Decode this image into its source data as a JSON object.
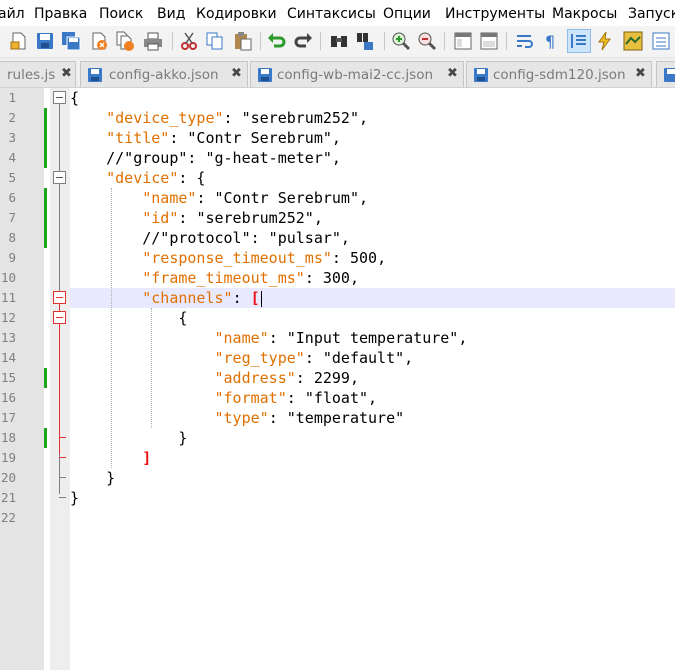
{
  "menu": {
    "items": [
      "айл",
      "Правка",
      "Поиск",
      "Вид",
      "Кодировки",
      "Синтаксисы",
      "Опции",
      "Инструменты",
      "Макросы",
      "Запуск"
    ]
  },
  "toolbar": {
    "buttons": [
      "new-file-icon",
      "save-icon",
      "save-all-icon",
      "close-icon",
      "close-all-icon",
      "print-icon",
      "cut-icon",
      "copy-icon",
      "paste-icon",
      "undo-icon",
      "redo-icon",
      "find-icon",
      "replace-icon",
      "zoom-in-icon",
      "zoom-out-icon",
      "sync-vertical-icon",
      "sync-horizontal-icon",
      "word-wrap-icon",
      "show-all-chars-icon",
      "indent-guide-icon",
      "user-defined-language-icon",
      "doc-map-icon",
      "function-list-icon"
    ]
  },
  "tabs": [
    {
      "label": "rules.js",
      "close": "✖"
    },
    {
      "label": "config-akko.json",
      "close": "✖"
    },
    {
      "label": "config-wb-mai2-cc.json",
      "close": "✖"
    },
    {
      "label": "config-sdm120.json",
      "close": "✖"
    }
  ],
  "editor": {
    "line_numbers": [
      "1",
      "2",
      "3",
      "4",
      "5",
      "6",
      "7",
      "8",
      "9",
      "10",
      "11",
      "12",
      "13",
      "14",
      "15",
      "16",
      "17",
      "18",
      "19",
      "20",
      "21",
      "22"
    ],
    "current_line": 11,
    "code": [
      {
        "i": "",
        "t": [
          [
            "p",
            "{"
          ]
        ]
      },
      {
        "i": "    ",
        "t": [
          [
            "k",
            "\"device_type\""
          ],
          [
            "p",
            ": "
          ],
          [
            "s",
            "\"serebrum252\""
          ],
          [
            "p",
            ","
          ]
        ]
      },
      {
        "i": "    ",
        "t": [
          [
            "k",
            "\"title\""
          ],
          [
            "p",
            ": "
          ],
          [
            "s",
            "\"Contr Serebrum\""
          ],
          [
            "p",
            ","
          ]
        ]
      },
      {
        "i": "    ",
        "t": [
          [
            "p",
            "//\"group\": \"g-heat-meter\","
          ]
        ]
      },
      {
        "i": "    ",
        "t": [
          [
            "k",
            "\"device\""
          ],
          [
            "p",
            ": {"
          ]
        ]
      },
      {
        "i": "        ",
        "t": [
          [
            "k",
            "\"name\""
          ],
          [
            "p",
            ": "
          ],
          [
            "s",
            "\"Contr Serebrum\""
          ],
          [
            "p",
            ","
          ]
        ]
      },
      {
        "i": "        ",
        "t": [
          [
            "k",
            "\"id\""
          ],
          [
            "p",
            ": "
          ],
          [
            "s",
            "\"serebrum252\""
          ],
          [
            "p",
            ","
          ]
        ]
      },
      {
        "i": "        ",
        "t": [
          [
            "p",
            "//\"protocol\": \"pulsar\","
          ]
        ]
      },
      {
        "i": "        ",
        "t": [
          [
            "k",
            "\"response_timeout_ms\""
          ],
          [
            "p",
            ": "
          ],
          [
            "n",
            "500"
          ],
          [
            "p",
            ","
          ]
        ]
      },
      {
        "i": "        ",
        "t": [
          [
            "k",
            "\"frame_timeout_ms\""
          ],
          [
            "p",
            ": "
          ],
          [
            "n",
            "300"
          ],
          [
            "p",
            ","
          ]
        ]
      },
      {
        "i": "        ",
        "t": [
          [
            "k",
            "\"channels\""
          ],
          [
            "p",
            ": "
          ],
          [
            "br",
            "["
          ]
        ]
      },
      {
        "i": "            ",
        "t": [
          [
            "p",
            "{"
          ]
        ]
      },
      {
        "i": "                ",
        "t": [
          [
            "k",
            "\"name\""
          ],
          [
            "p",
            ": "
          ],
          [
            "s",
            "\"Input temperature\""
          ],
          [
            "p",
            ","
          ]
        ]
      },
      {
        "i": "                ",
        "t": [
          [
            "k",
            "\"reg_type\""
          ],
          [
            "p",
            ": "
          ],
          [
            "s",
            "\"default\""
          ],
          [
            "p",
            ","
          ]
        ]
      },
      {
        "i": "                ",
        "t": [
          [
            "k",
            "\"address\""
          ],
          [
            "p",
            ": "
          ],
          [
            "n",
            "2299"
          ],
          [
            "p",
            ","
          ]
        ]
      },
      {
        "i": "                ",
        "t": [
          [
            "k",
            "\"format\""
          ],
          [
            "p",
            ": "
          ],
          [
            "s",
            "\"float\""
          ],
          [
            "p",
            ","
          ]
        ]
      },
      {
        "i": "                ",
        "t": [
          [
            "k",
            "\"type\""
          ],
          [
            "p",
            ": "
          ],
          [
            "s",
            "\"temperature\""
          ]
        ]
      },
      {
        "i": "            ",
        "t": [
          [
            "p",
            "}"
          ]
        ]
      },
      {
        "i": "        ",
        "t": [
          [
            "br",
            "]"
          ]
        ]
      },
      {
        "i": "    ",
        "t": [
          [
            "p",
            "}"
          ]
        ]
      },
      {
        "i": "",
        "t": [
          [
            "p",
            "}"
          ]
        ]
      },
      {
        "i": "",
        "t": []
      }
    ]
  },
  "colors": {
    "key": "#e07000",
    "bracket_match": "#ee1111",
    "change_marker": "#1ea51e",
    "current_line": "#e8e8ff"
  }
}
